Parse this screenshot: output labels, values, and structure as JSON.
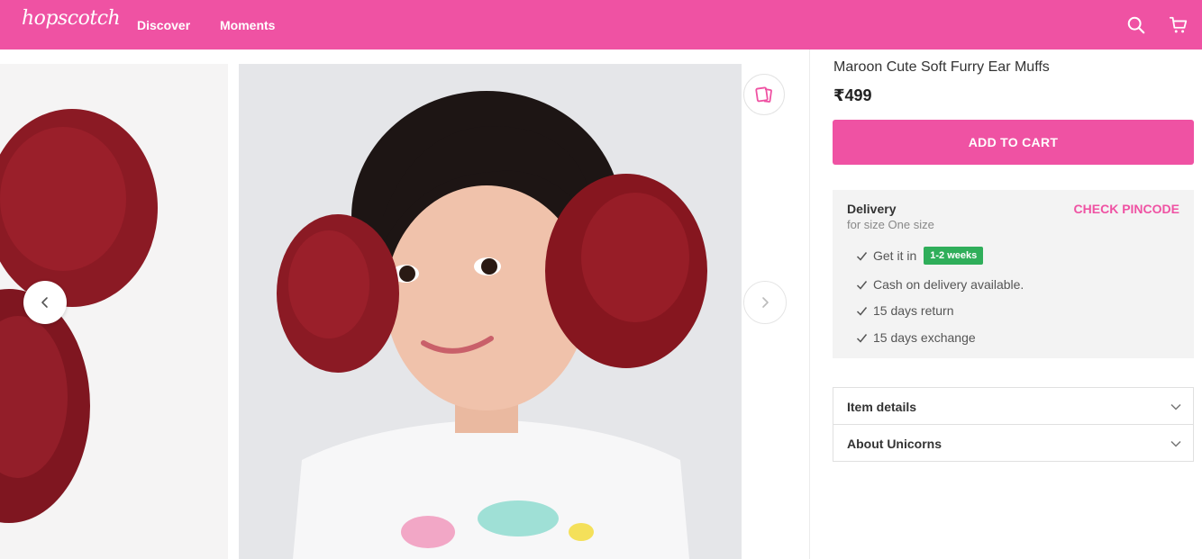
{
  "header": {
    "logo": "hopscotch",
    "nav": [
      "Discover",
      "Moments"
    ],
    "bg_color": "#ef52a3"
  },
  "icons": {
    "search": "search-icon",
    "cart": "cart-icon",
    "wishlist": "wishlist-icon",
    "prev": "chevron-left-icon",
    "next": "chevron-right-icon"
  },
  "product": {
    "title": "Maroon Cute Soft Furry Ear Muffs",
    "price": "₹499",
    "add_to_cart": "ADD TO CART"
  },
  "delivery": {
    "title": "Delivery",
    "subtitle": "for size One size",
    "check_pincode": "CHECK PINCODE",
    "get_it_in": "Get it in",
    "eta_badge": "1-2 weeks",
    "cod": "Cash on delivery available.",
    "return": "15 days return",
    "exchange": "15 days exchange"
  },
  "accordions": [
    "Item details",
    "About Unicorns"
  ],
  "colors": {
    "accent": "#ef52a3",
    "badge_green": "#2fae5a",
    "product_maroon": "#8b1a24"
  }
}
